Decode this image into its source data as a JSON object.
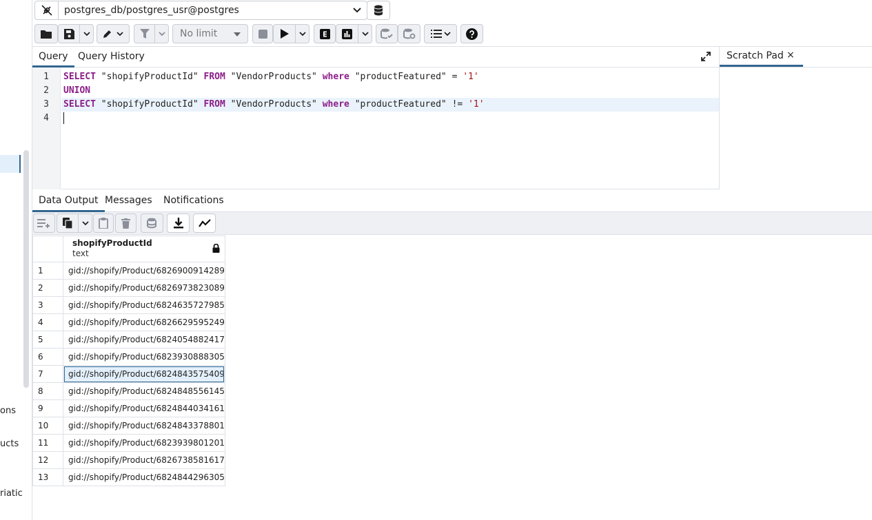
{
  "sidebar": {
    "fragments": [
      "ons",
      "ucts",
      "riatic"
    ]
  },
  "connection": {
    "label": "postgres_db/postgres_usr@postgres"
  },
  "toolbar": {
    "limit_label": "No limit"
  },
  "query_tabs": {
    "query": "Query",
    "history": "Query History"
  },
  "scratch_pad": {
    "label": "Scratch Pad",
    "close": "×"
  },
  "editor": {
    "line_numbers": [
      "1",
      "2",
      "3",
      "4"
    ],
    "lines": [
      [
        {
          "t": "SELECT",
          "c": "kw"
        },
        {
          "t": " ",
          "c": "op"
        },
        {
          "t": "\"shopifyProductId\"",
          "c": "id"
        },
        {
          "t": " ",
          "c": "op"
        },
        {
          "t": "FROM",
          "c": "kw"
        },
        {
          "t": " ",
          "c": "op"
        },
        {
          "t": "\"VendorProducts\"",
          "c": "id"
        },
        {
          "t": " ",
          "c": "op"
        },
        {
          "t": "where",
          "c": "kw"
        },
        {
          "t": " ",
          "c": "op"
        },
        {
          "t": "\"productFeatured\"",
          "c": "id"
        },
        {
          "t": " = ",
          "c": "op"
        },
        {
          "t": "'1'",
          "c": "str"
        }
      ],
      [
        {
          "t": "UNION",
          "c": "kw"
        }
      ],
      [
        {
          "t": "SELECT",
          "c": "kw"
        },
        {
          "t": " ",
          "c": "op"
        },
        {
          "t": "\"shopifyProductId\"",
          "c": "id"
        },
        {
          "t": " ",
          "c": "op"
        },
        {
          "t": "FROM",
          "c": "kw"
        },
        {
          "t": " ",
          "c": "op"
        },
        {
          "t": "\"VendorProducts\"",
          "c": "id"
        },
        {
          "t": " ",
          "c": "op"
        },
        {
          "t": "where",
          "c": "kw"
        },
        {
          "t": " ",
          "c": "op"
        },
        {
          "t": "\"productFeatured\"",
          "c": "id"
        },
        {
          "t": " != ",
          "c": "op"
        },
        {
          "t": "'1'",
          "c": "str"
        }
      ],
      []
    ]
  },
  "result_tabs": {
    "data_output": "Data Output",
    "messages": "Messages",
    "notifications": "Notifications"
  },
  "grid": {
    "column_name": "shopifyProductId",
    "column_type": "text",
    "selected_row": 7,
    "rows": [
      {
        "n": "1",
        "v": "gid://shopify/Product/6826900914289"
      },
      {
        "n": "2",
        "v": "gid://shopify/Product/6826973823089"
      },
      {
        "n": "3",
        "v": "gid://shopify/Product/6824635727985"
      },
      {
        "n": "4",
        "v": "gid://shopify/Product/6826629595249"
      },
      {
        "n": "5",
        "v": "gid://shopify/Product/6824054882417"
      },
      {
        "n": "6",
        "v": "gid://shopify/Product/6823930888305"
      },
      {
        "n": "7",
        "v": "gid://shopify/Product/6824843575409"
      },
      {
        "n": "8",
        "v": "gid://shopify/Product/6824848556145"
      },
      {
        "n": "9",
        "v": "gid://shopify/Product/6824844034161"
      },
      {
        "n": "10",
        "v": "gid://shopify/Product/6824843378801"
      },
      {
        "n": "11",
        "v": "gid://shopify/Product/6823939801201"
      },
      {
        "n": "12",
        "v": "gid://shopify/Product/6826738581617"
      },
      {
        "n": "13",
        "v": "gid://shopify/Product/6824844296305"
      }
    ]
  }
}
